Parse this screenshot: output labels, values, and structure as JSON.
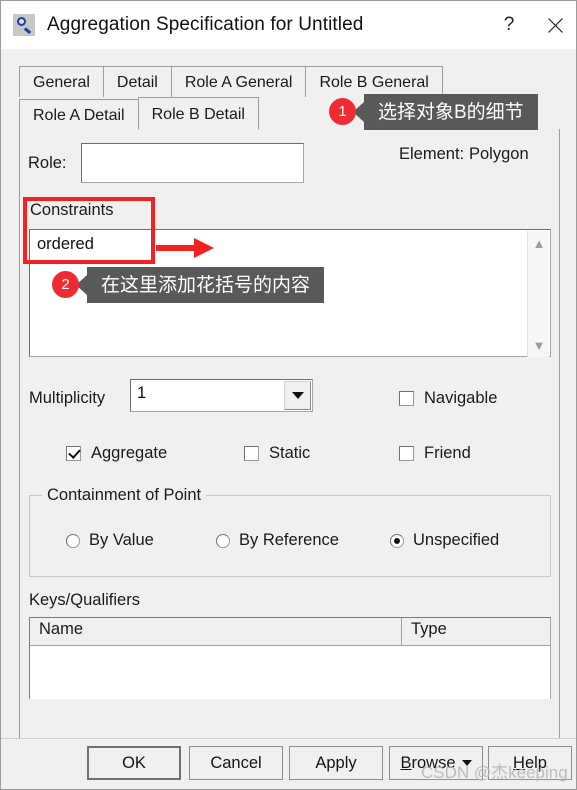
{
  "window": {
    "title": "Aggregation Specification for Untitled",
    "icon": "magnifier-icon",
    "help_button": "?",
    "close_button": "✕"
  },
  "tabs": {
    "row1": [
      {
        "label": "General",
        "active": false
      },
      {
        "label": "Detail",
        "active": false
      },
      {
        "label": "Role A General",
        "active": false
      },
      {
        "label": "Role B General",
        "active": false
      }
    ],
    "row2": [
      {
        "label": "Role A Detail",
        "active": false
      },
      {
        "label": "Role B Detail",
        "active": true
      }
    ]
  },
  "form": {
    "role_label": "Role:",
    "role_value": "",
    "role_placeholder": "",
    "element_label": "Element:",
    "element_value": "Polygon",
    "constraints_label": "Constraints",
    "constraints_value": "ordered",
    "multiplicity_label": "Multiplicity",
    "multiplicity_value": "1",
    "checkboxes": [
      {
        "label": "Navigable",
        "checked": false
      },
      {
        "label": "Aggregate",
        "checked": true
      },
      {
        "label": "Static",
        "checked": false
      },
      {
        "label": "Friend",
        "checked": false
      }
    ],
    "containment": {
      "group_title": "Containment of Point",
      "options": [
        {
          "label": "By Value",
          "selected": false
        },
        {
          "label": "By Reference",
          "selected": false
        },
        {
          "label": "Unspecified",
          "selected": true
        }
      ]
    },
    "keys": {
      "label": "Keys/Qualifiers",
      "columns": [
        "Name",
        "Type"
      ],
      "rows": []
    }
  },
  "buttons": {
    "ok": "OK",
    "cancel": "Cancel",
    "apply": "Apply",
    "browse_underlined": "B",
    "browse_rest": "rowse",
    "help_underlined": "H",
    "help_rest": "elp"
  },
  "annotations": {
    "badge1": "1",
    "tooltip1": "选择对象B的细节",
    "badge2": "2",
    "tooltip2": "在这里添加花括号的内容",
    "highlight_color": "#f32121",
    "badge_color": "#ee2c32",
    "tooltip_bg": "#595959"
  },
  "watermark": "CSDN @杰keeping"
}
